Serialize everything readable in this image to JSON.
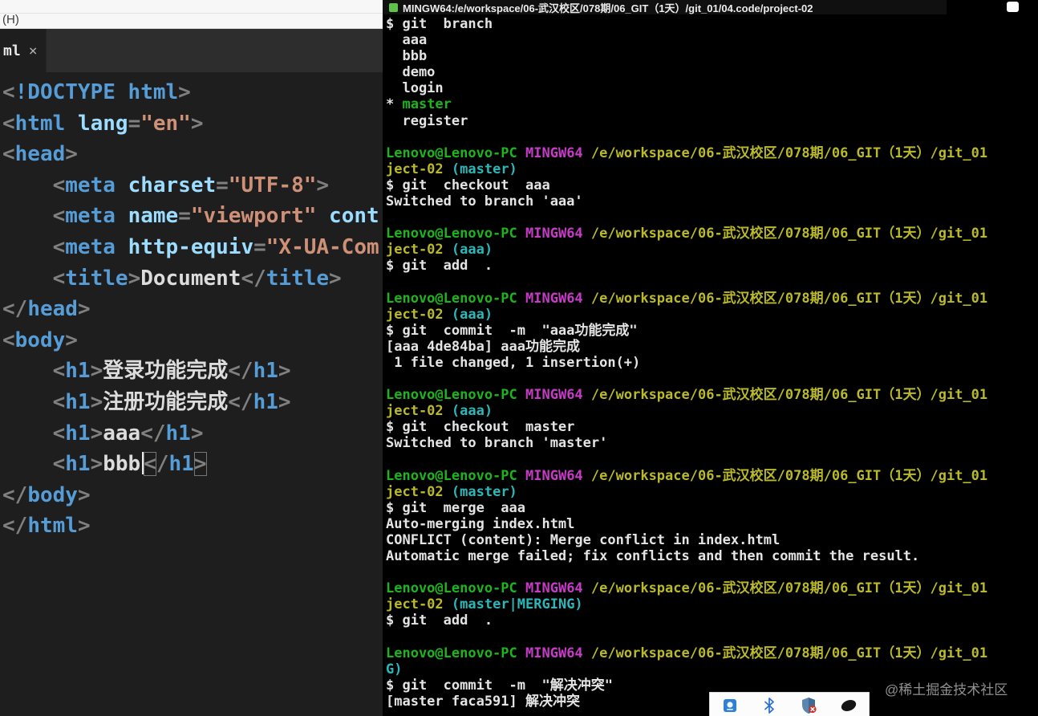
{
  "colors": {
    "editor_bg": "#1e1e1e",
    "terminal_bg": "#000000",
    "tag": "#569cd6",
    "attribute": "#9cdcfe",
    "string": "#ce9178",
    "punctuation": "#808080",
    "plain_text": "#dcdcdc",
    "prompt_user_green": "#1db41d",
    "prompt_shell_magenta": "#c73bc7",
    "prompt_path_yellow": "#b9b92a",
    "branch_cyan": "#2cb8b8"
  },
  "editor": {
    "menu_label": "(H)",
    "tab": {
      "label": "ml",
      "close_glyph": "×"
    },
    "code_lines": [
      [
        [
          "p",
          "<"
        ],
        [
          "tag",
          "!DOCTYPE html"
        ],
        [
          "p",
          ">"
        ]
      ],
      [
        [
          "p",
          "<"
        ],
        [
          "tag",
          "html"
        ],
        [
          "txt",
          " "
        ],
        [
          "attr",
          "lang"
        ],
        [
          "p",
          "="
        ],
        [
          "str",
          "\"en\""
        ],
        [
          "p",
          ">"
        ]
      ],
      [
        [
          "p",
          "<"
        ],
        [
          "tag",
          "head"
        ],
        [
          "p",
          ">"
        ]
      ],
      [
        [
          "txt",
          "    "
        ],
        [
          "p",
          "<"
        ],
        [
          "tag",
          "meta"
        ],
        [
          "txt",
          " "
        ],
        [
          "attr",
          "charset"
        ],
        [
          "p",
          "="
        ],
        [
          "str",
          "\"UTF-8\""
        ],
        [
          "p",
          ">"
        ]
      ],
      [
        [
          "txt",
          "    "
        ],
        [
          "p",
          "<"
        ],
        [
          "tag",
          "meta"
        ],
        [
          "txt",
          " "
        ],
        [
          "attr",
          "name"
        ],
        [
          "p",
          "="
        ],
        [
          "str",
          "\"viewport\""
        ],
        [
          "txt",
          " "
        ],
        [
          "attr",
          "cont"
        ]
      ],
      [
        [
          "txt",
          "    "
        ],
        [
          "p",
          "<"
        ],
        [
          "tag",
          "meta"
        ],
        [
          "txt",
          " "
        ],
        [
          "attr",
          "http-equiv"
        ],
        [
          "p",
          "="
        ],
        [
          "str",
          "\"X-UA-Com"
        ]
      ],
      [
        [
          "txt",
          "    "
        ],
        [
          "p",
          "<"
        ],
        [
          "tag",
          "title"
        ],
        [
          "p",
          ">"
        ],
        [
          "txt",
          "Document"
        ],
        [
          "p",
          "</"
        ],
        [
          "tag",
          "title"
        ],
        [
          "p",
          ">"
        ]
      ],
      [
        [
          "p",
          "</"
        ],
        [
          "tag",
          "head"
        ],
        [
          "p",
          ">"
        ]
      ],
      [
        [
          "p",
          "<"
        ],
        [
          "tag",
          "body"
        ],
        [
          "p",
          ">"
        ]
      ],
      [
        [
          "txt",
          "    "
        ],
        [
          "p",
          "<"
        ],
        [
          "tag",
          "h1"
        ],
        [
          "p",
          ">"
        ],
        [
          "txt",
          "登录功能完成"
        ],
        [
          "p",
          "</"
        ],
        [
          "tag",
          "h1"
        ],
        [
          "p",
          ">"
        ]
      ],
      [
        [
          "txt",
          "    "
        ],
        [
          "p",
          "<"
        ],
        [
          "tag",
          "h1"
        ],
        [
          "p",
          ">"
        ],
        [
          "txt",
          "注册功能完成"
        ],
        [
          "p",
          "</"
        ],
        [
          "tag",
          "h1"
        ],
        [
          "p",
          ">"
        ]
      ],
      [
        [
          "txt",
          "    "
        ],
        [
          "p",
          "<"
        ],
        [
          "tag",
          "h1"
        ],
        [
          "p",
          ">"
        ],
        [
          "txt",
          "aaa"
        ],
        [
          "p",
          "</"
        ],
        [
          "tag",
          "h1"
        ],
        [
          "p",
          ">"
        ]
      ],
      [
        [
          "txt",
          "    "
        ],
        [
          "p",
          "<"
        ],
        [
          "tag",
          "h1"
        ],
        [
          "p",
          ">"
        ],
        [
          "txt",
          "bbb"
        ],
        [
          "cur",
          ""
        ],
        [
          "p",
          "<",
          "boxed"
        ],
        [
          "p",
          "/"
        ],
        [
          "tag",
          "h1"
        ],
        [
          "p",
          ">",
          "boxed"
        ]
      ],
      [
        [
          "p",
          "</"
        ],
        [
          "tag",
          "body"
        ],
        [
          "p",
          ">"
        ]
      ],
      [
        [
          "p",
          "</"
        ],
        [
          "tag",
          "html"
        ],
        [
          "p",
          ">"
        ]
      ]
    ]
  },
  "terminal": {
    "title": "MINGW64:/e/workspace/06-武汉校区/078期/06_GIT（1天）/git_01/04.code/project-02",
    "lines": [
      [
        [
          "w",
          "$ git  branch"
        ]
      ],
      [
        [
          "w",
          "  aaa"
        ]
      ],
      [
        [
          "w",
          "  bbb"
        ]
      ],
      [
        [
          "w",
          "  demo"
        ]
      ],
      [
        [
          "w",
          "  login"
        ]
      ],
      [
        [
          "w",
          "* "
        ],
        [
          "g",
          "master"
        ]
      ],
      [
        [
          "w",
          "  register"
        ]
      ],
      [],
      [
        [
          "g",
          "Lenovo@Lenovo-PC"
        ],
        [
          "w",
          " "
        ],
        [
          "m",
          "MINGW64"
        ],
        [
          "w",
          " "
        ],
        [
          "y",
          "/e/workspace/06-武汉校区/078期/06_GIT（1天）/git_01"
        ]
      ],
      [
        [
          "y",
          "ject-02"
        ],
        [
          "w",
          " "
        ],
        [
          "c",
          "(master)"
        ]
      ],
      [
        [
          "w",
          "$ git  checkout  aaa"
        ]
      ],
      [
        [
          "w",
          "Switched to branch 'aaa'"
        ]
      ],
      [],
      [
        [
          "g",
          "Lenovo@Lenovo-PC"
        ],
        [
          "w",
          " "
        ],
        [
          "m",
          "MINGW64"
        ],
        [
          "w",
          " "
        ],
        [
          "y",
          "/e/workspace/06-武汉校区/078期/06_GIT（1天）/git_01"
        ]
      ],
      [
        [
          "y",
          "ject-02"
        ],
        [
          "w",
          " "
        ],
        [
          "c",
          "(aaa)"
        ]
      ],
      [
        [
          "w",
          "$ git  add  ."
        ]
      ],
      [],
      [
        [
          "g",
          "Lenovo@Lenovo-PC"
        ],
        [
          "w",
          " "
        ],
        [
          "m",
          "MINGW64"
        ],
        [
          "w",
          " "
        ],
        [
          "y",
          "/e/workspace/06-武汉校区/078期/06_GIT（1天）/git_01"
        ]
      ],
      [
        [
          "y",
          "ject-02"
        ],
        [
          "w",
          " "
        ],
        [
          "c",
          "(aaa)"
        ]
      ],
      [
        [
          "w",
          "$ git  commit  -m  \"aaa功能完成\""
        ]
      ],
      [
        [
          "w",
          "[aaa 4de84ba] aaa功能完成"
        ]
      ],
      [
        [
          "w",
          " 1 file changed, 1 insertion(+)"
        ]
      ],
      [],
      [
        [
          "g",
          "Lenovo@Lenovo-PC"
        ],
        [
          "w",
          " "
        ],
        [
          "m",
          "MINGW64"
        ],
        [
          "w",
          " "
        ],
        [
          "y",
          "/e/workspace/06-武汉校区/078期/06_GIT（1天）/git_01"
        ]
      ],
      [
        [
          "y",
          "ject-02"
        ],
        [
          "w",
          " "
        ],
        [
          "c",
          "(aaa)"
        ]
      ],
      [
        [
          "w",
          "$ git  checkout  master"
        ]
      ],
      [
        [
          "w",
          "Switched to branch 'master'"
        ]
      ],
      [],
      [
        [
          "g",
          "Lenovo@Lenovo-PC"
        ],
        [
          "w",
          " "
        ],
        [
          "m",
          "MINGW64"
        ],
        [
          "w",
          " "
        ],
        [
          "y",
          "/e/workspace/06-武汉校区/078期/06_GIT（1天）/git_01"
        ]
      ],
      [
        [
          "y",
          "ject-02"
        ],
        [
          "w",
          " "
        ],
        [
          "c",
          "(master)"
        ]
      ],
      [
        [
          "w",
          "$ git  merge  aaa"
        ]
      ],
      [
        [
          "w",
          "Auto-merging index.html"
        ]
      ],
      [
        [
          "w",
          "CONFLICT (content): Merge conflict in index.html"
        ]
      ],
      [
        [
          "w",
          "Automatic merge failed; fix conflicts and then commit the result."
        ]
      ],
      [],
      [
        [
          "g",
          "Lenovo@Lenovo-PC"
        ],
        [
          "w",
          " "
        ],
        [
          "m",
          "MINGW64"
        ],
        [
          "w",
          " "
        ],
        [
          "y",
          "/e/workspace/06-武汉校区/078期/06_GIT（1天）/git_01"
        ]
      ],
      [
        [
          "y",
          "ject-02"
        ],
        [
          "w",
          " "
        ],
        [
          "c",
          "(master|MERGING)"
        ]
      ],
      [
        [
          "w",
          "$ git  add  ."
        ]
      ],
      [],
      [
        [
          "g",
          "Lenovo@Lenovo-PC"
        ],
        [
          "w",
          " "
        ],
        [
          "m",
          "MINGW64"
        ],
        [
          "w",
          " "
        ],
        [
          "y",
          "/e/workspace/06-武汉校区/078期/06_GIT（1天）/git_01"
        ]
      ],
      [
        [
          "c",
          "G)"
        ]
      ],
      [
        [
          "w",
          "$ git  commit  -m  \"解决冲突\""
        ]
      ],
      [
        [
          "w",
          "[master faca591] 解决冲突"
        ]
      ]
    ]
  },
  "tray": {
    "icons": [
      "display-icon",
      "bluetooth-icon",
      "security-shield-icon",
      "mouse-icon"
    ]
  },
  "watermark": "@稀土掘金技术社区"
}
